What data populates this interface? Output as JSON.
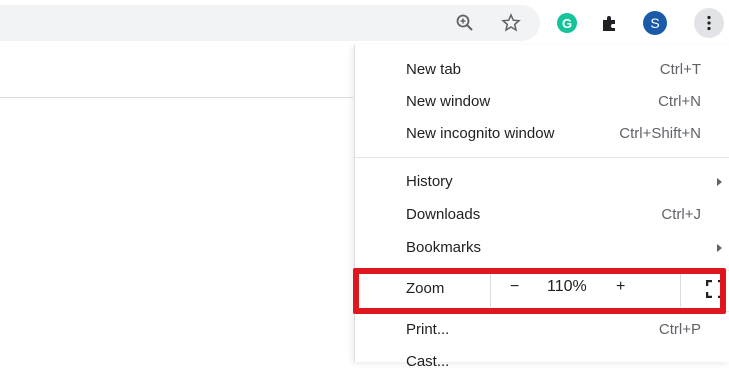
{
  "toolbar": {
    "icons": [
      "zoom-icon",
      "star-icon",
      "grammarly-icon",
      "puzzle-icon",
      "profile-avatar",
      "three-dot-menu-icon"
    ],
    "profile_initial": "S",
    "grammarly_initial": "G"
  },
  "menu": {
    "items": [
      {
        "label": "New tab",
        "shortcut": "Ctrl+T"
      },
      {
        "label": "New window",
        "shortcut": "Ctrl+N"
      },
      {
        "label": "New incognito window",
        "shortcut": "Ctrl+Shift+N"
      },
      {
        "label": "History",
        "shortcut": ""
      },
      {
        "label": "Downloads",
        "shortcut": "Ctrl+J"
      },
      {
        "label": "Bookmarks",
        "shortcut": ""
      },
      {
        "label": "Print...",
        "shortcut": "Ctrl+P"
      },
      {
        "label": "Cast...",
        "shortcut": ""
      }
    ],
    "zoom": {
      "label": "Zoom",
      "minus": "−",
      "value": "110%",
      "plus": "+",
      "fullscreen_icon": "fullscreen-icon"
    }
  },
  "colors": {
    "highlight": "#e0161e",
    "avatar": "#1a5aa8",
    "grammarly": "#15c39a"
  }
}
